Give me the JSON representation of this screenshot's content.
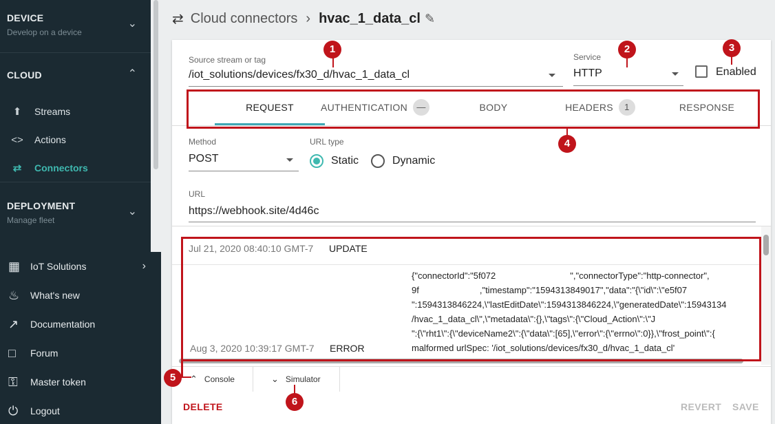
{
  "sidebar": {
    "device": {
      "title": "DEVICE",
      "subtitle": "Develop on a device"
    },
    "cloud": {
      "title": "CLOUD",
      "items": [
        {
          "label": "Streams",
          "icon": "upload-icon"
        },
        {
          "label": "Actions",
          "icon": "code-icon"
        },
        {
          "label": "Connectors",
          "icon": "swap-icon",
          "active": true
        }
      ]
    },
    "deployment": {
      "title": "DEPLOYMENT",
      "subtitle": "Manage fleet"
    },
    "lower": [
      {
        "label": "IoT Solutions",
        "icon": "building-icon"
      },
      {
        "label": "What's new",
        "icon": "flame-icon"
      },
      {
        "label": "Documentation",
        "icon": "external-link-icon"
      },
      {
        "label": "Forum",
        "icon": "chat-icon"
      },
      {
        "label": "Master token",
        "icon": "key-icon"
      },
      {
        "label": "Logout",
        "icon": "power-icon"
      }
    ]
  },
  "breadcrumb": {
    "parent": "Cloud connectors",
    "current": "hvac_1_data_cl"
  },
  "form": {
    "source_label": "Source stream or tag",
    "source_value": "/iot_solutions/devices/fx30_d/hvac_1_data_cl",
    "service_label": "Service",
    "service_value": "HTTP",
    "enabled_label": "Enabled",
    "method_label": "Method",
    "method_value": "POST",
    "urltype_label": "URL type",
    "urltype_static": "Static",
    "urltype_dynamic": "Dynamic",
    "url_label": "URL",
    "url_value": "https://webhook.site/4d46c"
  },
  "tabs": [
    {
      "label": "REQUEST",
      "active": true,
      "badge": ""
    },
    {
      "label": "AUTHENTICATION",
      "badge": "—"
    },
    {
      "label": "BODY",
      "badge": ""
    },
    {
      "label": "HEADERS",
      "badge": "1"
    },
    {
      "label": "RESPONSE",
      "badge": ""
    }
  ],
  "console": {
    "rows": [
      {
        "date": "Jul 21, 2020 08:40:10 GMT-7",
        "type": "UPDATE",
        "message": ""
      },
      {
        "date": "Aug 3, 2020 10:39:17 GMT-7",
        "type": "ERROR",
        "message_lines": [
          "{\"connectorId\":\"5f072",
          "9f",
          "\":1594313846224,\\\"lastEditDate\\\":1594313846224,\\\"generatedDate\\\":15943134",
          "/hvac_1_data_cl\\\",\\\"metadata\\\":{},\\\"tags\\\":{\\\"Cloud_Action\\\":\\\"J",
          "\":{\\\"rht1\\\":{\\\"deviceName2\\\":{\\\"data\\\":[65],\\\"error\\\":{\\\"errno\\\":0}},\\\"frost_point\\\":{",
          "malformed urlSpec: '/iot_solutions/devices/fx30_d/hvac_1_data_cl'"
        ],
        "message_line0_tail": "\",\"connectorType\":\"http-connector\",",
        "message_line1_tail": ",\"timestamp\":\"1594313849017\",\"data\":\"{\\\"id\\\":\\\"e5f07"
      }
    ]
  },
  "bottom_tabs": {
    "console": "Console",
    "simulator": "Simulator"
  },
  "actions": {
    "delete": "DELETE",
    "revert": "REVERT",
    "save": "SAVE"
  },
  "annotations": [
    "1",
    "2",
    "3",
    "4",
    "5",
    "6"
  ],
  "colors": {
    "accent": "#3fb9b0",
    "annotation": "#c0141b",
    "sidebar": "#1b2a32",
    "delete": "#c0141b"
  }
}
